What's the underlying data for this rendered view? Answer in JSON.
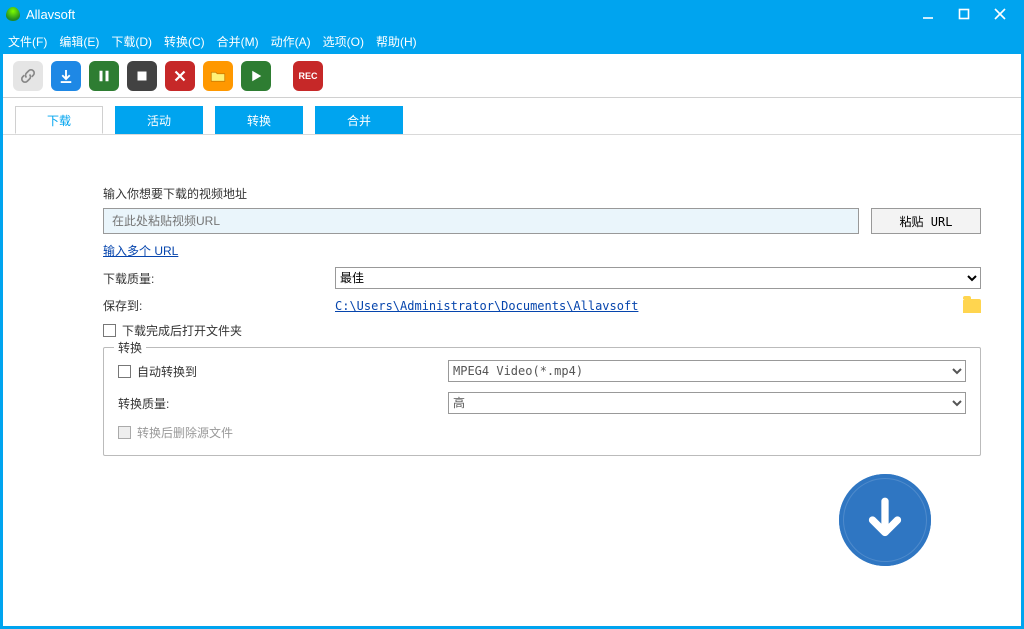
{
  "titlebar": {
    "title": "Allavsoft"
  },
  "menu": {
    "file": "文件(F)",
    "edit": "编辑(E)",
    "download": "下载(D)",
    "convert": "转换(C)",
    "merge": "合并(M)",
    "action": "动作(A)",
    "option": "选项(O)",
    "help": "帮助(H)"
  },
  "toolbar": {
    "rec": "REC"
  },
  "tabs": {
    "download": "下载",
    "activity": "活动",
    "convert": "转换",
    "merge": "合并"
  },
  "form": {
    "prompt": "输入你想要下载的视频地址",
    "url_placeholder": "在此处粘贴视频URL",
    "paste_btn": "粘贴 URL",
    "multi_url": "输入多个 URL",
    "quality_label": "下载质量:",
    "quality_value": "最佳",
    "saveto_label": "保存到:",
    "saveto_path": "C:\\Users\\Administrator\\Documents\\Allavsoft",
    "open_after": "下载完成后打开文件夹",
    "fieldset_legend": "转换",
    "auto_convert": "自动转换到",
    "format_value": "MPEG4 Video(*.mp4)",
    "conv_quality_label": "转换质量:",
    "conv_quality_value": "高",
    "delete_src": "转换后删除源文件"
  }
}
